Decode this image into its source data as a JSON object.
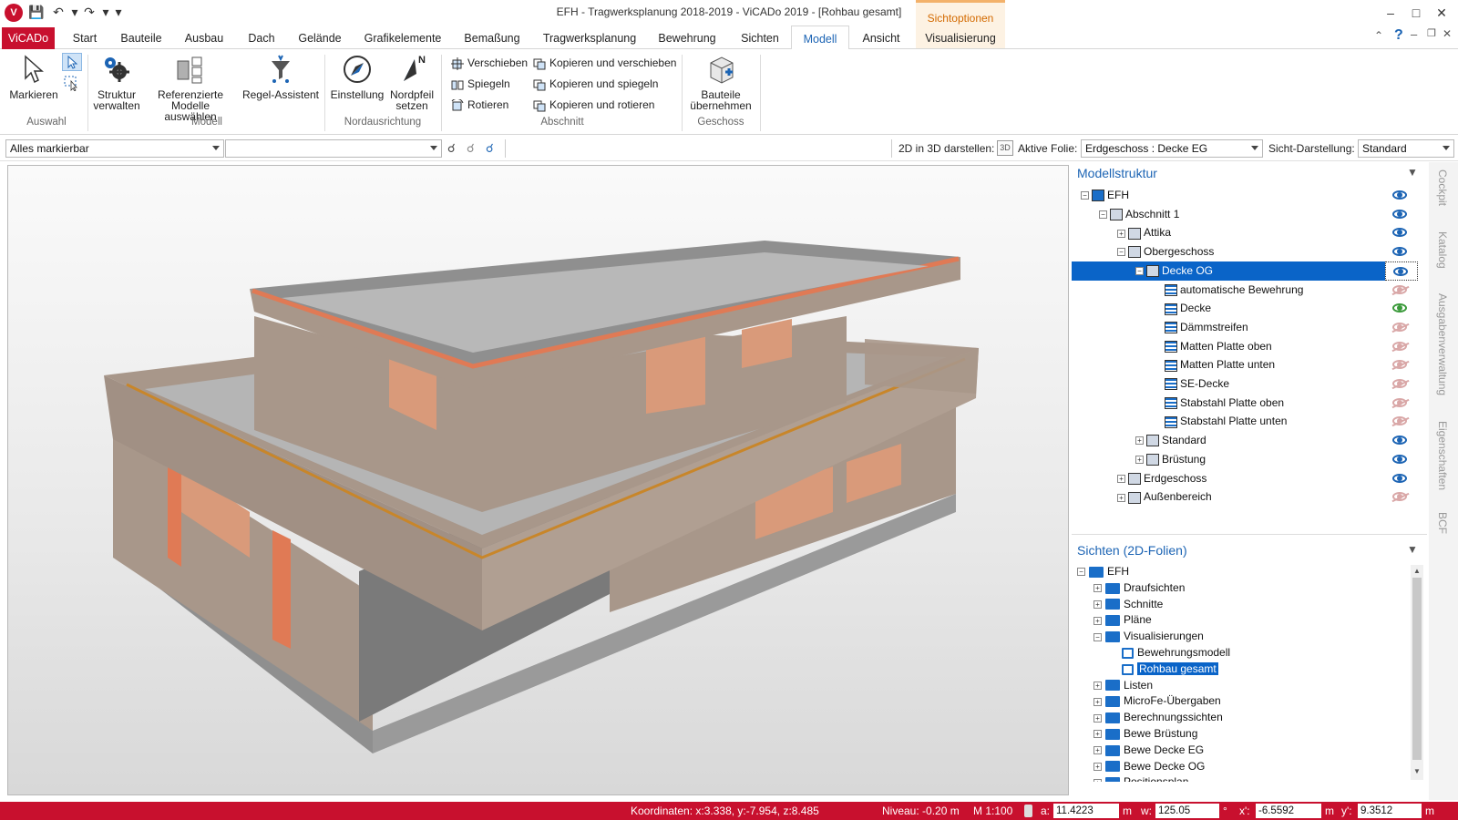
{
  "window": {
    "title": "EFH - Tragwerksplanung 2018-2019 - ViCADo 2019 - [Rohbau gesamt]",
    "context_tab_group": "Sichtoptionen",
    "logo_text": "V"
  },
  "tabs": [
    {
      "label": "ViCADo"
    },
    {
      "label": "Start"
    },
    {
      "label": "Bauteile"
    },
    {
      "label": "Ausbau"
    },
    {
      "label": "Dach"
    },
    {
      "label": "Gelände"
    },
    {
      "label": "Grafikelemente"
    },
    {
      "label": "Bemaßung"
    },
    {
      "label": "Tragwerksplanung"
    },
    {
      "label": "Bewehrung"
    },
    {
      "label": "Sichten"
    },
    {
      "label": "Modell"
    },
    {
      "label": "Ansicht"
    },
    {
      "label": "Visualisierung"
    }
  ],
  "ribbon": {
    "markieren": "Markieren",
    "struktur_1": "Struktur",
    "struktur_2": "verwalten",
    "ref_1": "Referenzierte",
    "ref_2": "Modelle auswählen",
    "regel": "Regel-Assistent",
    "einstellung": "Einstellung",
    "nordpfeil_1": "Nordpfeil",
    "nordpfeil_2": "setzen",
    "verschieben": "Verschieben",
    "spiegeln": "Spiegeln",
    "rotieren": "Rotieren",
    "kop_versch": "Kopieren und verschieben",
    "kop_spieg": "Kopieren und spiegeln",
    "kop_rot": "Kopieren und rotieren",
    "bauteile_1": "Bauteile",
    "bauteile_2": "übernehmen",
    "groups": {
      "auswahl": "Auswahl",
      "modell": "Modell",
      "nord": "Nordausrichtung",
      "abschnitt": "Abschnitt",
      "geschoss": "Geschoss"
    }
  },
  "toolbar2": {
    "filter_value": "Alles markierbar",
    "second_value": "",
    "label_2d3d": "2D in 3D darstellen:",
    "label_folie": "Aktive Folie:",
    "folie_value": "Erdgeschoss : Decke EG",
    "label_sicht": "Sicht-Darstellung:",
    "sicht_value": "Standard"
  },
  "modellstruktur": {
    "title": "Modellstruktur",
    "items": [
      {
        "label": "EFH",
        "level": 0,
        "exp": "−",
        "eye": "on"
      },
      {
        "label": "Abschnitt 1",
        "level": 1,
        "exp": "−",
        "eye": "on"
      },
      {
        "label": "Attika",
        "level": 2,
        "exp": "+",
        "eye": "on"
      },
      {
        "label": "Obergeschoss",
        "level": 2,
        "exp": "−",
        "eye": "on"
      },
      {
        "label": "Decke OG",
        "level": 3,
        "exp": "−",
        "eye": "on",
        "selected": true
      },
      {
        "label": "automatische Bewehrung",
        "level": 4,
        "exp": "",
        "eye": "off"
      },
      {
        "label": "Decke",
        "level": 4,
        "exp": "",
        "eye": "green"
      },
      {
        "label": "Dämmstreifen",
        "level": 4,
        "exp": "",
        "eye": "off"
      },
      {
        "label": "Matten Platte oben",
        "level": 4,
        "exp": "",
        "eye": "off"
      },
      {
        "label": "Matten Platte unten",
        "level": 4,
        "exp": "",
        "eye": "off"
      },
      {
        "label": "SE-Decke",
        "level": 4,
        "exp": "",
        "eye": "off"
      },
      {
        "label": "Stabstahl Platte oben",
        "level": 4,
        "exp": "",
        "eye": "off"
      },
      {
        "label": "Stabstahl Platte unten",
        "level": 4,
        "exp": "",
        "eye": "off"
      },
      {
        "label": "Standard",
        "level": 3,
        "exp": "+",
        "eye": "on"
      },
      {
        "label": "Brüstung",
        "level": 3,
        "exp": "+",
        "eye": "on"
      },
      {
        "label": "Erdgeschoss",
        "level": 2,
        "exp": "+",
        "eye": "on"
      },
      {
        "label": "Außenbereich",
        "level": 2,
        "exp": "+",
        "eye": "off"
      }
    ]
  },
  "sichten": {
    "title": "Sichten (2D-Folien)",
    "items": [
      {
        "label": "EFH",
        "level": 0,
        "exp": "−"
      },
      {
        "label": "Draufsichten",
        "level": 1,
        "exp": "+"
      },
      {
        "label": "Schnitte",
        "level": 1,
        "exp": "+"
      },
      {
        "label": "Pläne",
        "level": 1,
        "exp": "+"
      },
      {
        "label": "Visualisierungen",
        "level": 1,
        "exp": "−"
      },
      {
        "label": "Bewehrungsmodell",
        "level": 2,
        "exp": "",
        "view": true
      },
      {
        "label": "Rohbau gesamt",
        "level": 2,
        "exp": "",
        "view": true,
        "selected": true
      },
      {
        "label": "Listen",
        "level": 1,
        "exp": "+"
      },
      {
        "label": "MicroFe-Übergaben",
        "level": 1,
        "exp": "+"
      },
      {
        "label": "Berechnungssichten",
        "level": 1,
        "exp": "+"
      },
      {
        "label": "Bewe Brüstung",
        "level": 1,
        "exp": "+"
      },
      {
        "label": "Bewe Decke EG",
        "level": 1,
        "exp": "+"
      },
      {
        "label": "Bewe Decke OG",
        "level": 1,
        "exp": "+"
      },
      {
        "label": "Positionsplan",
        "level": 1,
        "exp": "+"
      }
    ]
  },
  "side_tabs": [
    "Cockpit",
    "Katalog",
    "Ausgabenverwaltung",
    "Eigenschaften",
    "BCF"
  ],
  "status": {
    "coords": "Koordinaten: x:3.338, y:-7.954, z:8.485",
    "niveau": "Niveau: -0.20 m",
    "scale": "M 1:100",
    "a_label": "a:",
    "a_value": "11.4223",
    "a_unit": "m",
    "w_label": "w:",
    "w_value": "125.05",
    "w_unit": "°",
    "x_label": "x':",
    "x_value": "-6.5592",
    "x_unit": "m",
    "y_label": "y':",
    "y_value": "9.3512",
    "y_unit": "m"
  },
  "colors": {
    "brand_red": "#c8102e",
    "accent_blue": "#1c64b4",
    "selection": "#0a64c8"
  }
}
